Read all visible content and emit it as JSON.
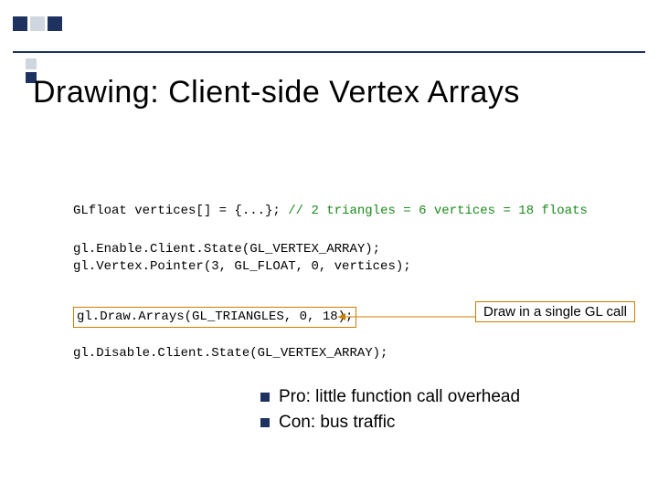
{
  "title": "Drawing:  Client-side Vertex Arrays",
  "code": {
    "line_decl_a": "GLfloat vertices[] = {...}; ",
    "line_decl_comment": "// 2 triangles = 6 vertices = 18 floats",
    "line_enable": "gl.Enable.Client.State(GL_VERTEX_ARRAY);",
    "line_vertexptr": "gl.Vertex.Pointer(3, GL_FLOAT, 0, vertices);",
    "line_draw": "gl.Draw.Arrays(GL_TRIANGLES, 0, 18);",
    "line_disable": "gl.Disable.Client.State(GL_VERTEX_ARRAY);"
  },
  "annotation": "Draw in a single GL call",
  "bullets": [
    "Pro:  little function call overhead",
    "Con:  bus traffic"
  ]
}
